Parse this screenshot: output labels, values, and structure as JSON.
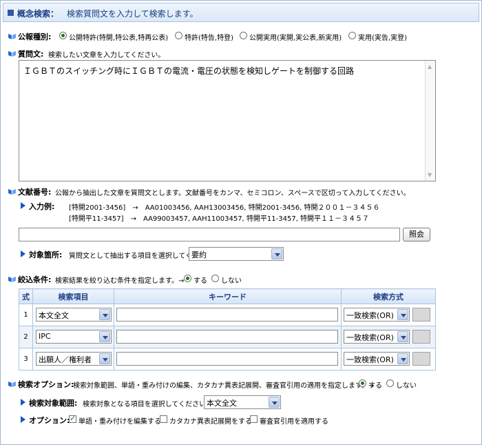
{
  "header": {
    "title": "概念検索：",
    "description": "検索質問文を入力して検索します。"
  },
  "publication_type": {
    "label": "公報種別:",
    "options": [
      {
        "label": "公開特許(特開,特公表,特再公表)",
        "selected": true
      },
      {
        "label": "特許(特告,特登)",
        "selected": false
      },
      {
        "label": "公開実用(実開,実公表,新実用)",
        "selected": false
      },
      {
        "label": "実用(実告,実登)",
        "selected": false
      }
    ]
  },
  "question": {
    "label": "質問文:",
    "hint": "検索したい文章を入力してください。",
    "value": "ＩＧＢＴのスイッチング時にＩＧＢＴの電流・電圧の状態を検知しゲートを制御する回路"
  },
  "document_number": {
    "label": "文献番号:",
    "hint": "公報から抽出した文章を質問文とします。文献番号をカンマ、セミコロン、スペースで区切って入力してください。",
    "example_label": "入力例:",
    "example_lines": [
      "[特開2001-3456]　→　AA01003456,  AAH13003456,  特開2001-3456,  特開２００１－３４５６",
      "[特開平11-3457]　→　AA99003457,  AAH11003457,  特開平11-3457,  特開平１１－３４５７"
    ],
    "input_value": "",
    "lookup_button": "照会",
    "target_label": "対象箇所:",
    "target_hint": "質問文として抽出する項目を選択してください。→",
    "target_value": "要約"
  },
  "filter": {
    "label": "絞込条件:",
    "hint": "検索結果を絞り込む条件を指定します。→",
    "on_label": "する",
    "off_label": "しない",
    "on_selected": true,
    "columns": [
      "式",
      "検索項目",
      "キーワード",
      "検索方式"
    ],
    "rows": [
      {
        "num": "1",
        "field": "本文全文",
        "keyword": "",
        "method": "一致検索(OR)"
      },
      {
        "num": "2",
        "field": "IPC",
        "keyword": "",
        "method": "一致検索(OR)"
      },
      {
        "num": "3",
        "field": "出願人／権利者",
        "keyword": "",
        "method": "一致検索(OR)"
      }
    ]
  },
  "search_options": {
    "label": "検索オプション:",
    "hint": "検索対象範囲、単語・重み付けの編集、カタカナ異表記展開、審査官引用の適用を指定します。→",
    "on_label": "する",
    "off_label": "しない",
    "on_selected": true,
    "scope_label": "検索対象範囲:",
    "scope_hint": "検索対象となる項目を選択してください。→",
    "scope_value": "本文全文",
    "options_label": "オプション:",
    "checkboxes": [
      {
        "label": "単語・重み付けを編集する",
        "checked": true
      },
      {
        "label": "カタカナ異表記展開をする",
        "checked": false
      },
      {
        "label": "審査官引用を適用する",
        "checked": false
      }
    ]
  },
  "colors": {
    "accent": "#1c3e85",
    "bullet": "#1e56c4",
    "table_border": "#a9c2e2"
  },
  "icons": {
    "section_bullet": "book-icon",
    "sub_bullet": "triangle-right-icon"
  }
}
